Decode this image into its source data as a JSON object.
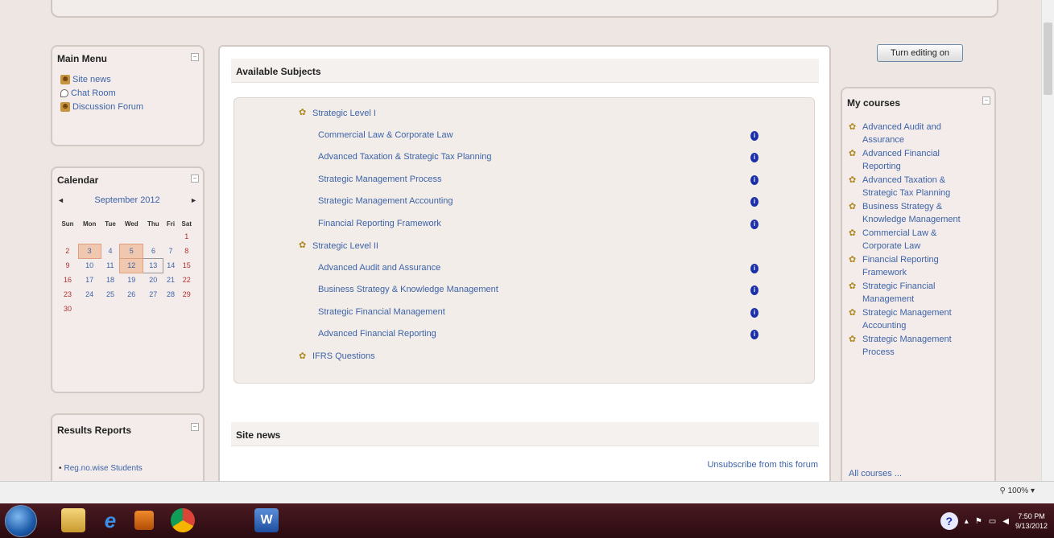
{
  "main_menu": {
    "title": "Main Menu",
    "items": [
      {
        "label": "Site news",
        "icon": "person-icon"
      },
      {
        "label": "Chat Room",
        "icon": "chat-icon"
      },
      {
        "label": "Discussion Forum",
        "icon": "person-icon"
      }
    ]
  },
  "calendar": {
    "title": "Calendar",
    "month": "September 2012",
    "prev": "◄",
    "next": "►",
    "weekdays": [
      "Sun",
      "Mon",
      "Tue",
      "Wed",
      "Thu",
      "Fri",
      "Sat"
    ],
    "weeks": [
      [
        "",
        "",
        "",
        "",
        "",
        "",
        "1"
      ],
      [
        "2",
        "3",
        "4",
        "5",
        "6",
        "7",
        "8"
      ],
      [
        "9",
        "10",
        "11",
        "12",
        "13",
        "14",
        "15"
      ],
      [
        "16",
        "17",
        "18",
        "19",
        "20",
        "21",
        "22"
      ],
      [
        "23",
        "24",
        "25",
        "26",
        "27",
        "28",
        "29"
      ],
      [
        "30",
        "",
        "",
        "",
        "",
        "",
        ""
      ]
    ],
    "event_days": [
      "3",
      "5",
      "12"
    ],
    "today": "13"
  },
  "results_reports": {
    "title": "Results Reports",
    "items": [
      "Reg.no.wise Students"
    ]
  },
  "main": {
    "available_subjects_title": "Available Subjects",
    "categories": [
      {
        "name": "Strategic Level I",
        "courses": [
          "Commercial Law & Corporate Law",
          "Advanced Taxation & Strategic Tax Planning",
          "Strategic Management Process",
          "Strategic Management Accounting",
          "Financial Reporting Framework"
        ]
      },
      {
        "name": "Strategic Level II",
        "courses": [
          "Advanced Audit and Assurance",
          "Business Strategy & Knowledge Management",
          "Strategic Financial Management",
          "Advanced Financial Reporting"
        ]
      },
      {
        "name": "IFRS Questions",
        "courses": []
      }
    ],
    "site_news_title": "Site news",
    "unsubscribe_label": "Unsubscribe from this forum"
  },
  "edit_button_label": "Turn editing on",
  "my_courses": {
    "title": "My courses",
    "items": [
      [
        "Advanced Audit and",
        "Assurance"
      ],
      [
        "Advanced Financial",
        "Reporting"
      ],
      [
        "Advanced Taxation &",
        "Strategic Tax Planning"
      ],
      [
        "Business Strategy &",
        "Knowledge Management"
      ],
      [
        "Commercial Law &",
        "Corporate Law"
      ],
      [
        "Financial Reporting",
        "Framework"
      ],
      [
        "Strategic Financial",
        "Management"
      ],
      [
        "Strategic Management",
        "Accounting"
      ],
      [
        "Strategic Management",
        "Process"
      ]
    ],
    "all_courses_label": "All courses ..."
  },
  "status_bar": {
    "zoom": "100%"
  },
  "taskbar": {
    "clock_time": "7:50 PM",
    "clock_date": "9/13/2012",
    "word_label": "W"
  },
  "colors": {
    "link": "#3d63a8",
    "info_icon": "#1a2fa8",
    "taskbar": "#3a1018"
  }
}
